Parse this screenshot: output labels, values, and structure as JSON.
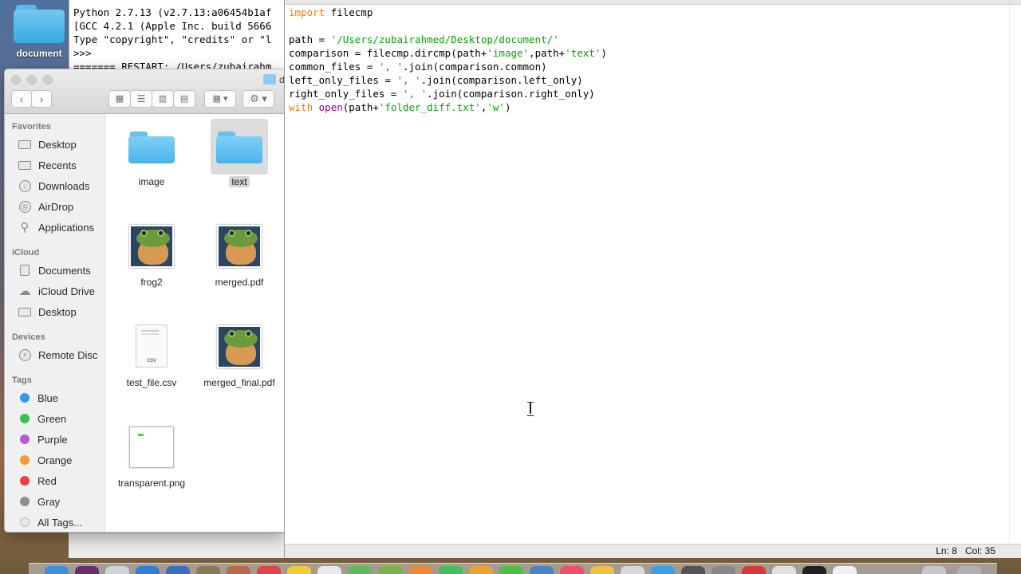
{
  "desktop": {
    "folder_label": "document"
  },
  "shell": {
    "lines": [
      "Python 2.7.13 (v2.7.13:a06454b1af",
      "[GCC 4.2.1 (Apple Inc. build 5666",
      "Type \"copyright\", \"credits\" or \"l",
      ">>> ",
      "======= RESTART: /Users/zubairahm"
    ]
  },
  "finder": {
    "title": "d",
    "sidebar": {
      "favorites_header": "Favorites",
      "favorites": [
        "Desktop",
        "Recents",
        "Downloads",
        "AirDrop",
        "Applications"
      ],
      "icloud_header": "iCloud",
      "icloud": [
        "Documents",
        "iCloud Drive",
        "Desktop"
      ],
      "devices_header": "Devices",
      "devices": [
        "Remote Disc"
      ],
      "tags_header": "Tags",
      "tags": [
        {
          "name": "Blue",
          "color": "#2e9bf0"
        },
        {
          "name": "Green",
          "color": "#37c24a"
        },
        {
          "name": "Purple",
          "color": "#b45ad6"
        },
        {
          "name": "Orange",
          "color": "#f59a2d"
        },
        {
          "name": "Red",
          "color": "#ec3f3f"
        },
        {
          "name": "Gray",
          "color": "#8e8e93"
        },
        {
          "name": "All Tags...",
          "color": ""
        }
      ]
    },
    "files": [
      "image",
      "text",
      "frog2",
      "merged.pdf",
      "test_file.csv",
      "merged_final.pdf",
      "transparent.png"
    ],
    "csv_ext": "csv"
  },
  "editor": {
    "code_lines": [
      [
        {
          "t": "import",
          "c": "kw"
        },
        {
          "t": " filecmp",
          "c": ""
        }
      ],
      [],
      [
        {
          "t": "path = ",
          "c": ""
        },
        {
          "t": "'/Users/zubairahmed/Desktop/document/'",
          "c": "str"
        }
      ],
      [
        {
          "t": "comparison = filecmp.dircmp(path+",
          "c": ""
        },
        {
          "t": "'image'",
          "c": "str"
        },
        {
          "t": ",path+",
          "c": ""
        },
        {
          "t": "'text'",
          "c": "str"
        },
        {
          "t": ")",
          "c": ""
        }
      ],
      [
        {
          "t": "common_files = ",
          "c": ""
        },
        {
          "t": "', '",
          "c": "str"
        },
        {
          "t": ".join(comparison.common)",
          "c": ""
        }
      ],
      [
        {
          "t": "left_only_files = ",
          "c": ""
        },
        {
          "t": "', '",
          "c": "str"
        },
        {
          "t": ".join(comparison.left_only)",
          "c": ""
        }
      ],
      [
        {
          "t": "right_only_files = ",
          "c": ""
        },
        {
          "t": "', '",
          "c": "str"
        },
        {
          "t": ".join(comparison.right_only)",
          "c": ""
        }
      ],
      [
        {
          "t": "with",
          "c": "kw"
        },
        {
          "t": " ",
          "c": ""
        },
        {
          "t": "open",
          "c": "bi"
        },
        {
          "t": "(path+",
          "c": ""
        },
        {
          "t": "'folder_diff.txt'",
          "c": "str"
        },
        {
          "t": ",",
          "c": ""
        },
        {
          "t": "'w'",
          "c": "str"
        },
        {
          "t": ")",
          "c": ""
        }
      ]
    ],
    "status": {
      "line": "Ln: 8",
      "col": "Col: 35"
    }
  },
  "colors": {
    "keyword": "#ff7700",
    "string": "#00aa00",
    "builtin": "#900090"
  }
}
